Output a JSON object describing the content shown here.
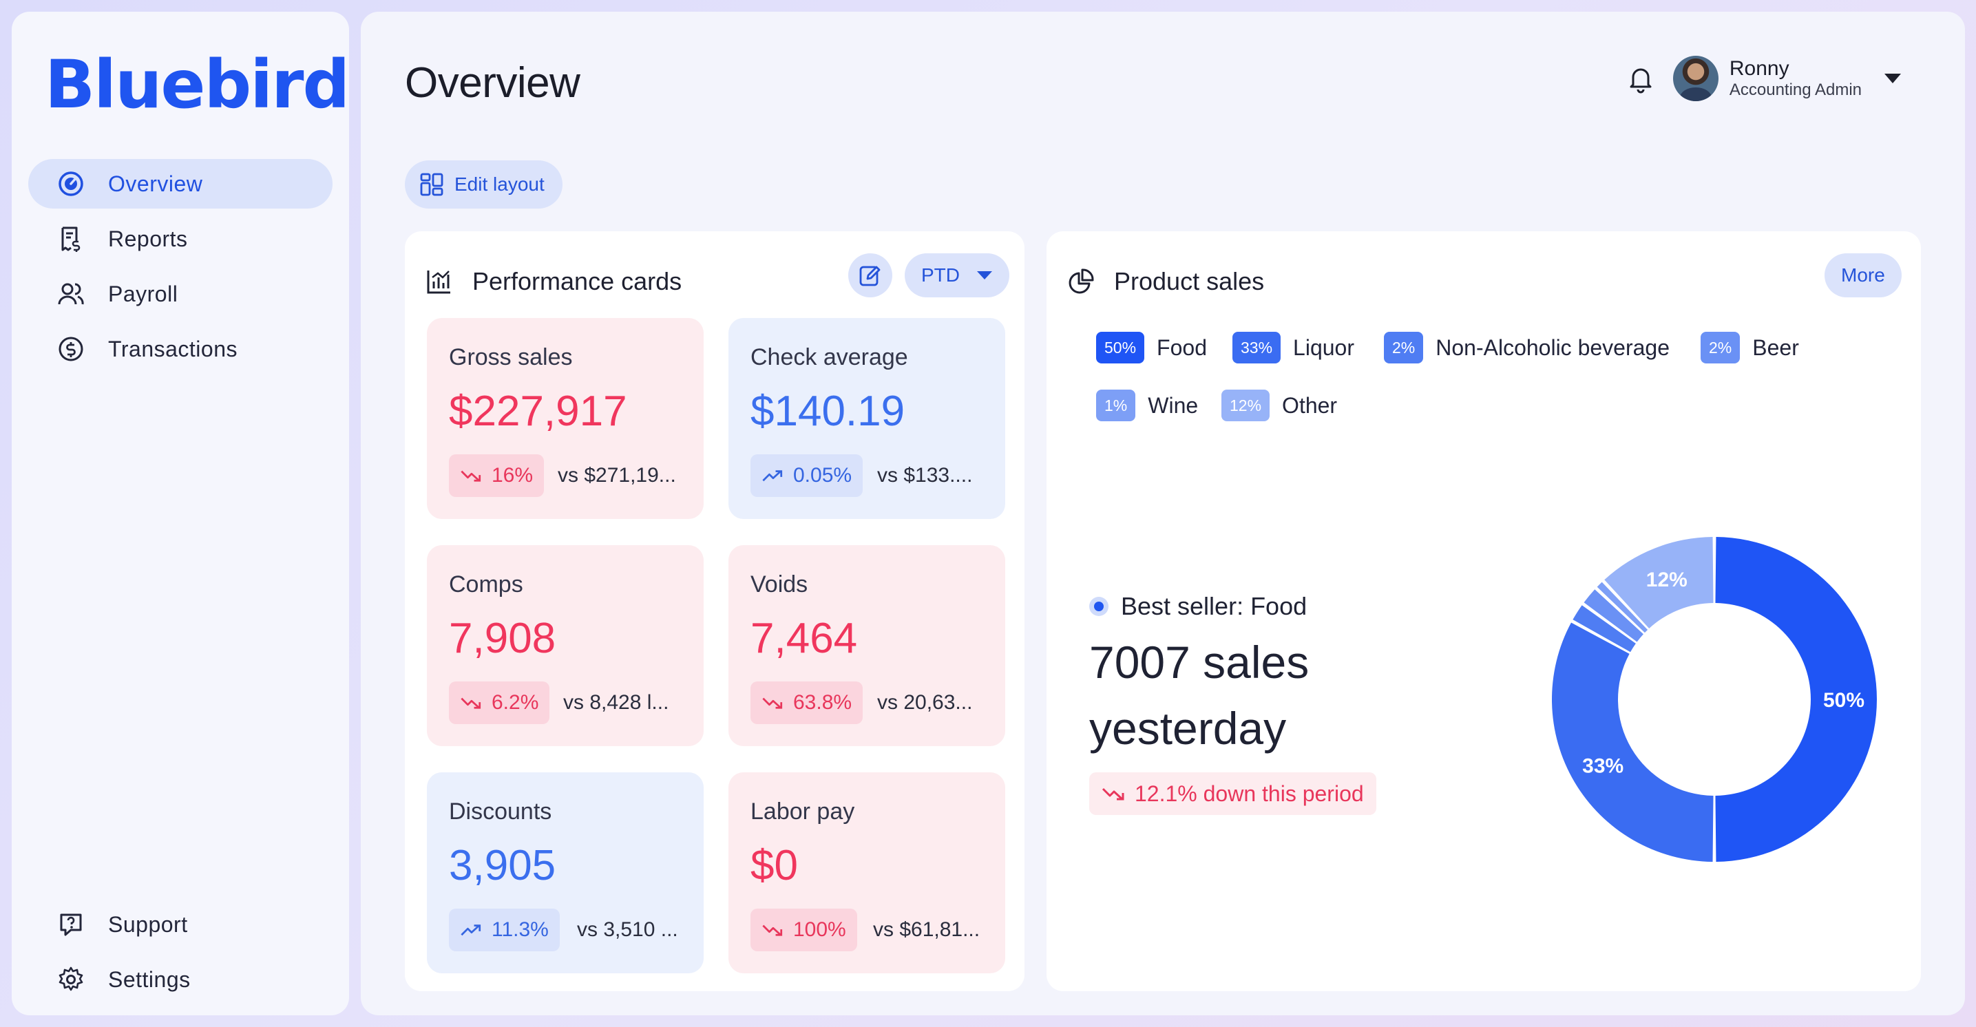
{
  "app": {
    "logo": "Bluebird"
  },
  "sidebar": {
    "items": [
      {
        "label": "Overview",
        "icon": "speedometer-icon",
        "active": true
      },
      {
        "label": "Reports",
        "icon": "receipt-icon"
      },
      {
        "label": "Payroll",
        "icon": "users-icon"
      },
      {
        "label": "Transactions",
        "icon": "dollar-circle-icon"
      }
    ],
    "bottom": [
      {
        "label": "Support",
        "icon": "help-chat-icon"
      },
      {
        "label": "Settings",
        "icon": "gear-icon"
      }
    ]
  },
  "header": {
    "title": "Overview",
    "user": {
      "name": "Ronny",
      "role": "Accounting Admin"
    }
  },
  "toolbar": {
    "edit_layout": "Edit layout"
  },
  "performance": {
    "title": "Performance cards",
    "period": "PTD",
    "cards": [
      {
        "label": "Gross sales",
        "value": "$227,917",
        "change": "16%",
        "trend": "down",
        "compare": "vs $271,19...",
        "tone": "red"
      },
      {
        "label": "Check average",
        "value": "$140.19",
        "change": "0.05%",
        "trend": "up",
        "compare": "vs $133....",
        "tone": "blue"
      },
      {
        "label": "Comps",
        "value": "7,908",
        "change": "6.2%",
        "trend": "down",
        "compare": "vs 8,428 l...",
        "tone": "red"
      },
      {
        "label": "Voids",
        "value": "7,464",
        "change": "63.8%",
        "trend": "down",
        "compare": "vs 20,63...",
        "tone": "red"
      },
      {
        "label": "Discounts",
        "value": "3,905",
        "change": "11.3%",
        "trend": "up",
        "compare": "vs 3,510 ...",
        "tone": "blue"
      },
      {
        "label": "Labor pay",
        "value": "$0",
        "change": "100%",
        "trend": "down",
        "compare": "vs $61,81...",
        "tone": "red"
      }
    ]
  },
  "product_sales": {
    "title": "Product sales",
    "more": "More",
    "legend": [
      {
        "pct": "50%",
        "label": "Food",
        "color": "#1f55f5"
      },
      {
        "pct": "33%",
        "label": "Liquor",
        "color": "#3a6cf2"
      },
      {
        "pct": "2%",
        "label": "Non-Alcoholic beverage",
        "color": "#4f7df3"
      },
      {
        "pct": "2%",
        "label": "Beer",
        "color": "#6a91f5"
      },
      {
        "pct": "1%",
        "label": "Wine",
        "color": "#7d9ff6"
      },
      {
        "pct": "12%",
        "label": "Other",
        "color": "#97b3f8"
      }
    ],
    "best_seller": "Best seller: Food",
    "big_text": "7007 sales yesterday",
    "change_text": "12.1% down this period"
  },
  "chart_data": {
    "type": "pie",
    "categories": [
      "Food",
      "Liquor",
      "Non-Alcoholic beverage",
      "Beer",
      "Wine",
      "Other"
    ],
    "values": [
      50,
      33,
      2,
      2,
      1,
      12
    ],
    "data_labels": [
      "50%",
      "33%",
      "",
      "",
      "",
      "12%"
    ],
    "colors": [
      "#1f55f5",
      "#3a6cf2",
      "#4f7df3",
      "#6a91f5",
      "#7d9ff6",
      "#97b3f8"
    ]
  }
}
